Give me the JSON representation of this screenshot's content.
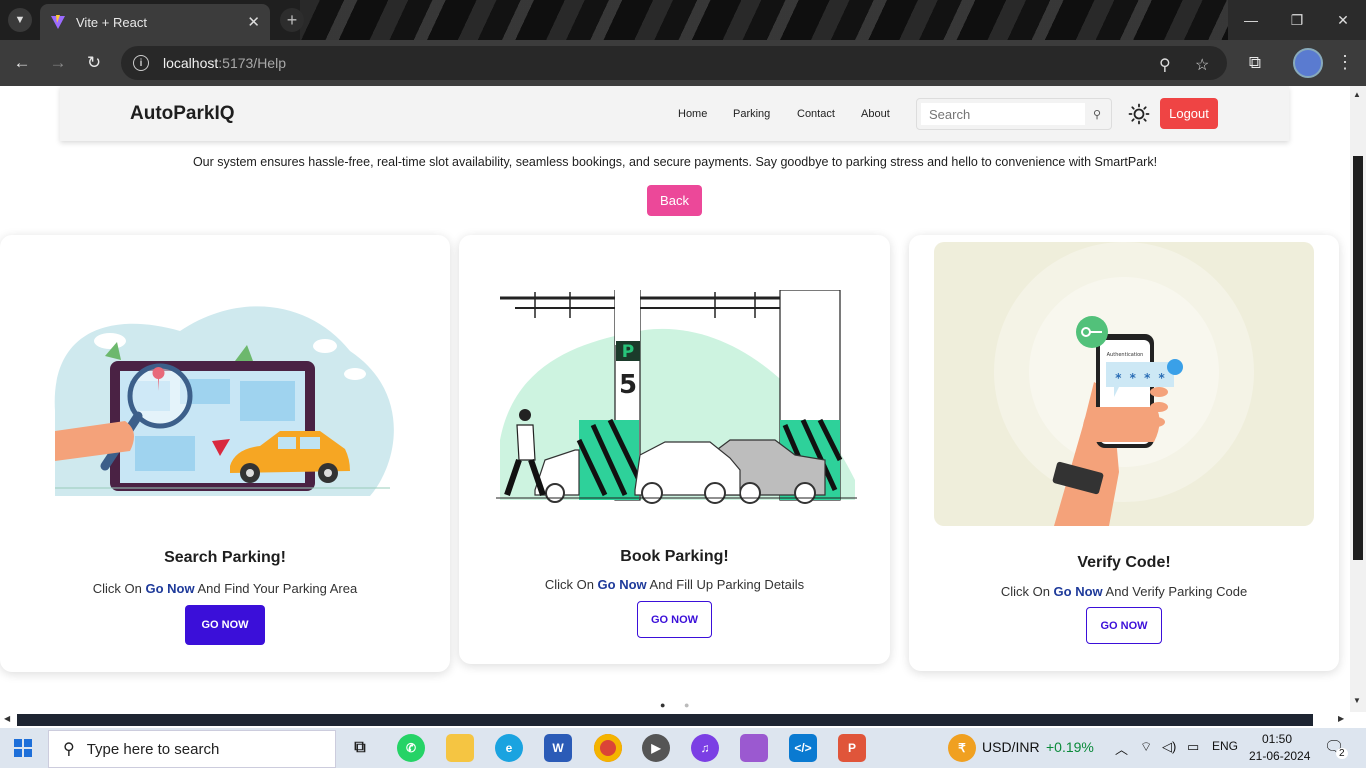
{
  "browser": {
    "tab_title": "Vite + React",
    "url_host": "localhost",
    "url_path": ":5173/Help"
  },
  "app": {
    "brand": "AutoParkIQ",
    "nav": [
      "Home",
      "Parking",
      "Contact",
      "About"
    ],
    "search_placeholder": "Search",
    "logout_label": "Logout"
  },
  "page": {
    "intro": "Our system ensures hassle-free, real-time slot availability, seamless bookings, and secure payments. Say goodbye to parking stress and hello to convenience with SmartPark!",
    "back_label": "Back"
  },
  "cards": [
    {
      "title": "Search Parking!",
      "desc_prefix": "Click On ",
      "desc_highlight": "Go Now",
      "desc_suffix": " And Find Your Parking Area",
      "button": "GO NOW"
    },
    {
      "title": "Book Parking!",
      "desc_prefix": "Click On ",
      "desc_highlight": "Go Now",
      "desc_suffix": " And Fill Up Parking Details",
      "button": "GO NOW"
    },
    {
      "title": "Verify Code!",
      "desc_prefix": "Click On ",
      "desc_highlight": "Go Now",
      "desc_suffix": " And Verify Parking Code",
      "button": "GO NOW"
    }
  ],
  "illustration_text": {
    "parking_sign": "P",
    "level_number": "5",
    "auth_screen": "Authentication",
    "code_mask": "* * * *"
  },
  "taskbar": {
    "search_placeholder": "Type here to search",
    "currency": "USD/INR",
    "currency_change": "+0.19%",
    "language": "ENG",
    "time": "01:50",
    "date": "21-06-2024",
    "notifications": "2"
  },
  "colors": {
    "logout": "#ef4444",
    "back": "#ec4899",
    "go_now": "#3b0fd9",
    "highlight": "#1e3a9a",
    "currency_change": "#0a8a3a"
  }
}
